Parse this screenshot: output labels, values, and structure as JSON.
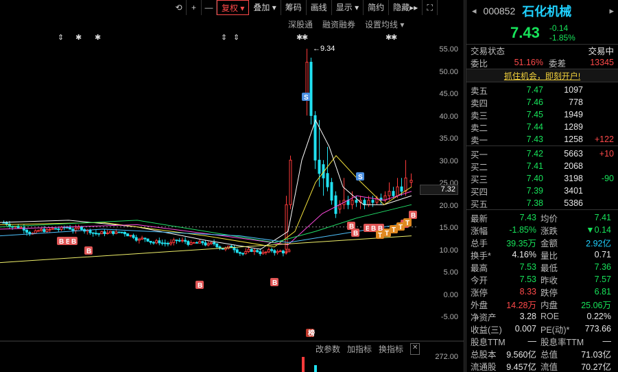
{
  "toolbar": {
    "refresh_icon": "refresh-icon",
    "plus": "+",
    "minus": "—",
    "fuquan": "复权",
    "diejia": "叠加",
    "chouma": "筹码",
    "huaxian": "画线",
    "xianshi": "显示",
    "jianyue": "简约",
    "yincang": "隐藏",
    "more": "▸▸",
    "fullscreen_icon": "fullscreen-icon"
  },
  "subbar": {
    "shengutong": "深股通",
    "rongzi": "融资融券",
    "setma": "设置均线"
  },
  "marks": {
    "star_text": "✱",
    "updown_text": "⇕"
  },
  "axis": {
    "ticks": [
      "55.00",
      "50.00",
      "45.00",
      "40.00",
      "35.00",
      "30.00",
      "25.00",
      "20.00",
      "15.00",
      "10.00",
      "5.00",
      "0.00",
      "-5.00"
    ],
    "current_price": "7.32",
    "volume_tick": "272.00"
  },
  "annotations": {
    "peak": "9.34",
    "s": "S",
    "b": "B",
    "t": "T",
    "bang": "榜"
  },
  "bottombar": {
    "gaicanshu": "改参数",
    "jiazhibiao": "加指标",
    "huanzhibiao": "换指标",
    "close": "✕"
  },
  "stock": {
    "code": "000852",
    "name": "石化机械",
    "price": "7.43",
    "change": "-0.14",
    "change_pct": "-1.85%"
  },
  "trade": {
    "status_label": "交易状态",
    "status_value": "交易中",
    "weibi_label": "委比",
    "weibi_value": "51.16%",
    "weicha_label": "委差",
    "weicha_value": "13345"
  },
  "ad": "抓住机会，即刻开户!",
  "asks": [
    {
      "label": "卖五",
      "price": "7.47",
      "vol": "1097",
      "chg": ""
    },
    {
      "label": "卖四",
      "price": "7.46",
      "vol": "778",
      "chg": ""
    },
    {
      "label": "卖三",
      "price": "7.45",
      "vol": "1949",
      "chg": ""
    },
    {
      "label": "卖二",
      "price": "7.44",
      "vol": "1289",
      "chg": ""
    },
    {
      "label": "卖一",
      "price": "7.43",
      "vol": "1258",
      "chg": "+122"
    }
  ],
  "bids": [
    {
      "label": "买一",
      "price": "7.42",
      "vol": "5663",
      "chg": "+10"
    },
    {
      "label": "买二",
      "price": "7.41",
      "vol": "2068",
      "chg": ""
    },
    {
      "label": "买三",
      "price": "7.40",
      "vol": "3198",
      "chg": "-90"
    },
    {
      "label": "买四",
      "price": "7.39",
      "vol": "3401",
      "chg": ""
    },
    {
      "label": "买五",
      "price": "7.38",
      "vol": "5386",
      "chg": ""
    }
  ],
  "quotes": [
    {
      "l1": "最新",
      "v1": "7.43",
      "l2": "均价",
      "v2": "7.41"
    },
    {
      "l1": "涨幅",
      "v1": "-1.85%",
      "l2": "涨跌",
      "v2": "▼0.14"
    },
    {
      "l1": "总手",
      "v1": "39.35万",
      "l2": "金额",
      "v2": "2.92亿"
    },
    {
      "l1": "换手*",
      "v1": "4.16%",
      "l2": "量比",
      "v2": "0.71"
    },
    {
      "l1": "最高",
      "v1": "7.53",
      "l2": "最低",
      "v2": "7.36"
    },
    {
      "l1": "今开",
      "v1": "7.53",
      "l2": "昨收",
      "v2": "7.57"
    },
    {
      "l1": "涨停",
      "v1": "8.33",
      "l2": "跌停",
      "v2": "6.81"
    },
    {
      "l1": "外盘",
      "v1": "14.28万",
      "l2": "内盘",
      "v2": "25.06万"
    },
    {
      "l1": "净资产",
      "v1": "3.28",
      "l2": "ROE",
      "v2": "0.22%"
    },
    {
      "l1": "收益(三)",
      "v1": "0.007",
      "l2": "PE(动)*",
      "v2": "773.66"
    },
    {
      "l1": "股息TTM",
      "v1": "—",
      "l2": "股息率TTM",
      "v2": "—"
    },
    {
      "l1": "总股本",
      "v1": "9.560亿",
      "l2": "总值",
      "v2": "71.03亿"
    },
    {
      "l1": "流通股",
      "v1": "9.457亿",
      "l2": "流值",
      "v2": "70.27亿"
    }
  ]
}
